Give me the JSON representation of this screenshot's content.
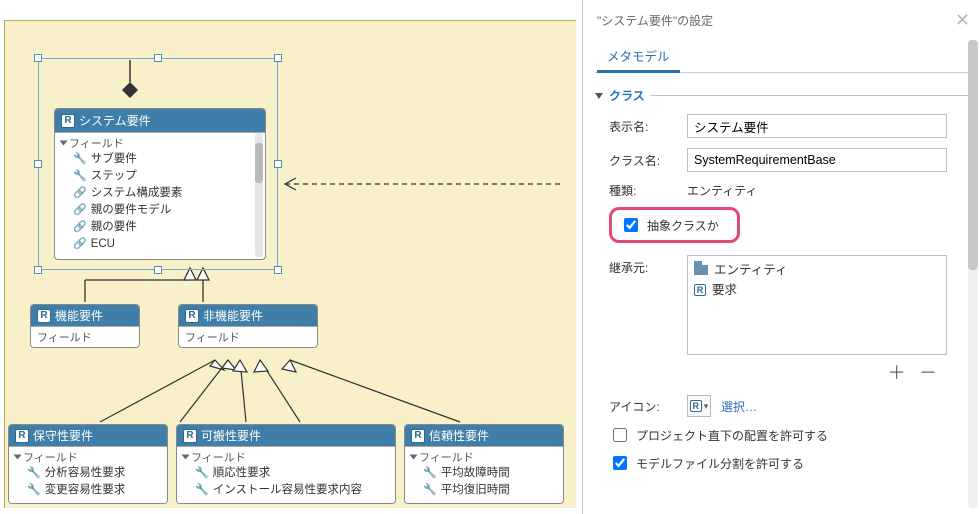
{
  "panel": {
    "title": "\"システム要件\"の設定",
    "tab": "メタモデル",
    "section_class": "クラス",
    "labels": {
      "display_name": "表示名:",
      "class_name": "クラス名:",
      "kind": "種類:",
      "abstract": "抽象クラスか",
      "inherit_from": "継承元:",
      "icon": "アイコン:",
      "select": "選択…",
      "allow_project_root": "プロジェクト直下の配置を許可する",
      "allow_split": "モデルファイル分割を許可する"
    },
    "values": {
      "display_name": "システム要件",
      "class_name": "SystemRequirementBase",
      "kind": "エンティティ"
    },
    "inherit": [
      "エンティティ",
      "要求"
    ],
    "checks": {
      "abstract": true,
      "allow_project_root": false,
      "allow_split": true
    }
  },
  "diagram": {
    "main": {
      "title": "システム要件",
      "section": "フィールド",
      "fields": [
        {
          "icon": "wrench",
          "label": "サブ要件"
        },
        {
          "icon": "wrench",
          "label": "ステップ"
        },
        {
          "icon": "chain",
          "label": "システム構成要素"
        },
        {
          "icon": "chain",
          "label": "親の要件モデル"
        },
        {
          "icon": "chain",
          "label": "親の要件"
        },
        {
          "icon": "chain",
          "label": "ECU"
        }
      ]
    },
    "children1": [
      {
        "title": "機能要件",
        "section": "フィールド"
      },
      {
        "title": "非機能要件",
        "section": "フィールド"
      }
    ],
    "children2": [
      {
        "title": "保守性要件",
        "section": "フィールド",
        "fields": [
          {
            "icon": "wrench",
            "label": "分析容易性要求"
          },
          {
            "icon": "wrench",
            "label": "変更容易性要求"
          }
        ]
      },
      {
        "title": "可搬性要件",
        "section": "フィールド",
        "fields": [
          {
            "icon": "wrench",
            "label": "順応性要求"
          },
          {
            "icon": "wrench",
            "label": "インストール容易性要求内容"
          }
        ]
      },
      {
        "title": "信頼性要件",
        "section": "フィールド",
        "fields": [
          {
            "icon": "wrench",
            "label": "平均故障時間"
          },
          {
            "icon": "wrench",
            "label": "平均復旧時間"
          }
        ]
      }
    ]
  }
}
